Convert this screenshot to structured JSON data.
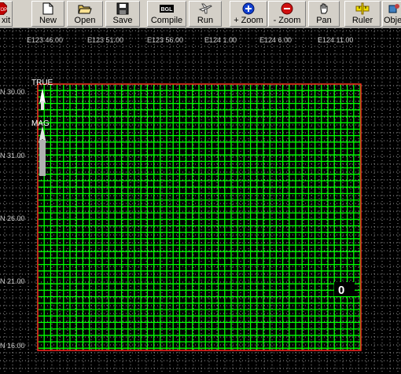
{
  "toolbar": {
    "buttons": [
      {
        "name": "exit-button",
        "icon": "stop-icon",
        "label": "xit"
      },
      {
        "name": "new-button",
        "icon": "new-file-icon",
        "label": "New"
      },
      {
        "name": "open-button",
        "icon": "open-folder-icon",
        "label": "Open"
      },
      {
        "name": "save-button",
        "icon": "floppy-disk-icon",
        "label": "Save"
      },
      {
        "name": "compile-button",
        "icon": "compile-icon",
        "label": "Compile"
      },
      {
        "name": "run-button",
        "icon": "airplane-icon",
        "label": "Run"
      },
      {
        "name": "zoom-in-button",
        "icon": "zoom-in-icon",
        "label": "+ Zoom"
      },
      {
        "name": "zoom-out-button",
        "icon": "zoom-out-icon",
        "label": "- Zoom"
      },
      {
        "name": "pan-button",
        "icon": "hand-icon",
        "label": "Pan"
      },
      {
        "name": "ruler-button",
        "icon": "ruler-icon",
        "label": "Ruler"
      },
      {
        "name": "objects-button",
        "icon": "objects-icon",
        "label": "Obje"
      }
    ],
    "compile_icon_text": "BGL"
  },
  "map": {
    "background_color": "#000000",
    "longitude_labels": [
      "E123 46.00",
      "E123 51.00",
      "E123 56.00",
      "E124 1.00",
      "E124 6.00",
      "E124 11.00"
    ],
    "latitude_labels": [
      "N 30.00",
      "N 31.00",
      "N 26.00",
      "N 21.00",
      "N 16.00"
    ],
    "compass": {
      "true_label": "TRUE",
      "mag_label": "MAG"
    },
    "marker_label": "0",
    "colors": {
      "mesh": "#00ff00",
      "boundary": "#ff2020",
      "dotted_grid": "#c8c8c8",
      "coord_label": "#c8c8c8"
    }
  }
}
